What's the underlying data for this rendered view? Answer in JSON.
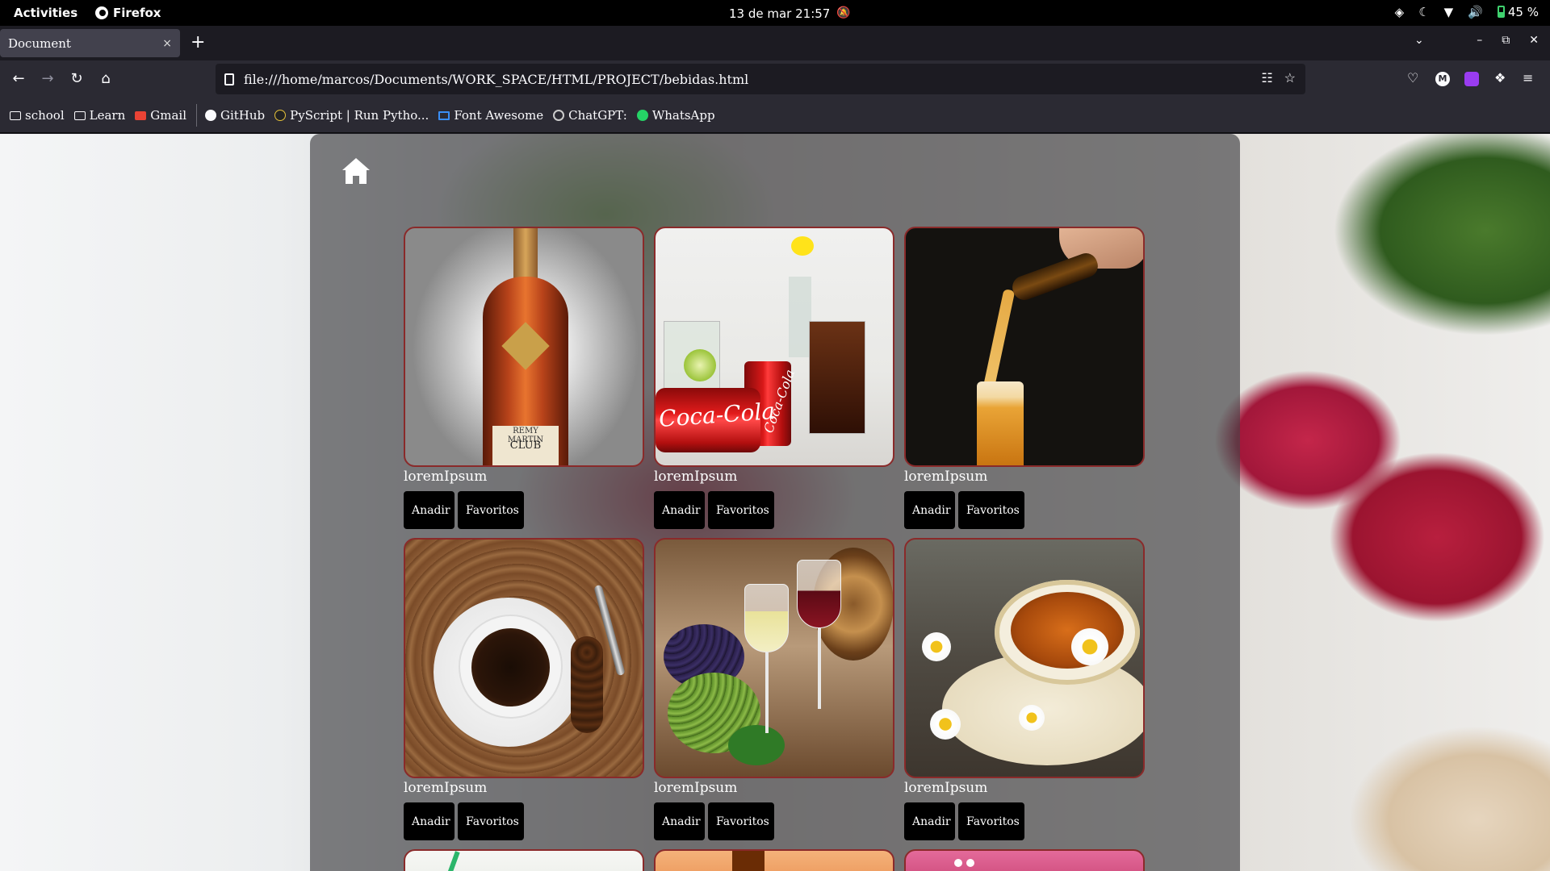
{
  "topbar": {
    "activities": "Activities",
    "app_name": "Firefox",
    "clock": "13 de mar  21:57",
    "battery": "45 %"
  },
  "browser": {
    "tab_title": "Document",
    "tab_close": "×",
    "new_tab": "+",
    "url": "file:///home/marcos/Documents/WORK_SPACE/HTML/PROJECT/bebidas.html"
  },
  "bookmarks": [
    {
      "label": "school",
      "icon": "folder-icon"
    },
    {
      "label": "Learn",
      "icon": "folder-icon"
    },
    {
      "label": "Gmail",
      "icon": "gmail-icon"
    },
    {
      "label": "GitHub",
      "icon": "github-icon"
    },
    {
      "label": "PyScript  |  Run Pytho...",
      "icon": "pyscript-icon"
    },
    {
      "label": "Font Awesome",
      "icon": "flag-icon"
    },
    {
      "label": "ChatGPT:",
      "icon": "chatgpt-icon"
    },
    {
      "label": "WhatsApp",
      "icon": "whatsapp-icon"
    }
  ],
  "page": {
    "home_icon": "home-icon",
    "cards": [
      {
        "caption": "loremIpsum",
        "add_label": "Anadir",
        "fav_label": "Favoritos",
        "image": "cognac-bottle"
      },
      {
        "caption": "loremIpsum",
        "add_label": "Anadir",
        "fav_label": "Favoritos",
        "image": "coca-cola"
      },
      {
        "caption": "loremIpsum",
        "add_label": "Anadir",
        "fav_label": "Favoritos",
        "image": "beer-pour"
      },
      {
        "caption": "loremIpsum",
        "add_label": "Anadir",
        "fav_label": "Favoritos",
        "image": "coffee-cup"
      },
      {
        "caption": "loremIpsum",
        "add_label": "Anadir",
        "fav_label": "Favoritos",
        "image": "wine-grapes"
      },
      {
        "caption": "loremIpsum",
        "add_label": "Anadir",
        "fav_label": "Favoritos",
        "image": "chamomile-tea"
      }
    ],
    "image_labels": {
      "remy": "REMY MARTIN",
      "club": "CLUB",
      "coke": "Coca-Cola",
      "coke_can": "Coca-Cola"
    }
  },
  "colors": {
    "tab_bg": "#42414d",
    "toolbar_bg": "#2b2a33",
    "button_bg": "#000000",
    "card_border": "#8a2a2a"
  }
}
